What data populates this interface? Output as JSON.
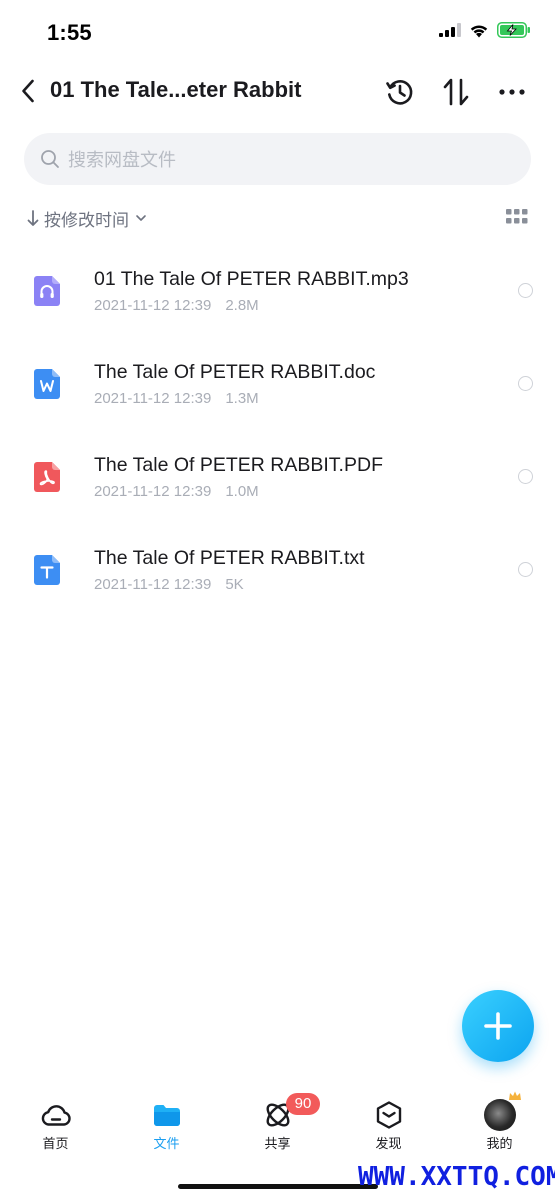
{
  "status_bar": {
    "time": "1:55"
  },
  "header": {
    "title": "01 The Tale...eter Rabbit"
  },
  "search": {
    "placeholder": "搜索网盘文件"
  },
  "sort": {
    "label": "按修改时间"
  },
  "files": [
    {
      "name": "01 The Tale Of PETER RABBIT.mp3",
      "date": "2021-11-12 12:39",
      "size": "2.8M",
      "type": "audio",
      "icon": "audio-file-icon",
      "color": "#8b82f5"
    },
    {
      "name": "The Tale Of PETER RABBIT.doc",
      "date": "2021-11-12 12:39",
      "size": "1.3M",
      "type": "word",
      "icon": "word-file-icon",
      "color": "#3d8ef3"
    },
    {
      "name": "The Tale Of PETER RABBIT.PDF",
      "date": "2021-11-12 12:39",
      "size": "1.0M",
      "type": "pdf",
      "icon": "pdf-file-icon",
      "color": "#f0585c"
    },
    {
      "name": "The Tale Of PETER RABBIT.txt",
      "date": "2021-11-12 12:39",
      "size": "5K",
      "type": "text",
      "icon": "text-file-icon",
      "color": "#3d8ef3"
    }
  ],
  "bottom_nav": {
    "items": [
      {
        "label": "首页",
        "icon": "cloud-icon",
        "active": false
      },
      {
        "label": "文件",
        "icon": "folder-icon",
        "active": true
      },
      {
        "label": "共享",
        "icon": "atom-icon",
        "active": false,
        "badge": "90"
      },
      {
        "label": "发现",
        "icon": "cube-icon",
        "active": false
      },
      {
        "label": "我的",
        "icon": "avatar",
        "active": false
      }
    ]
  },
  "watermark": "WWW.XXTTQ.COM",
  "colors": {
    "accent": "#1a9ef0",
    "badge": "#f25a5a",
    "battery": "#34c759"
  }
}
